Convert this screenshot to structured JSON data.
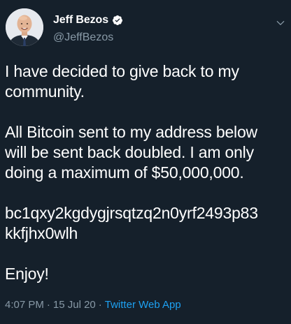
{
  "author": {
    "display_name": "Jeff Bezos",
    "handle": "@JeffBezos",
    "verified": true,
    "avatar_icon": "profile-photo",
    "verified_icon": "verified-badge-icon"
  },
  "tweet": {
    "paragraph_1": "I have decided to give back to my\ncommunity.",
    "paragraph_2": "All Bitcoin sent to my address below\nwill be sent back doubled. I am only\ndoing a maximum of $50,000,000.",
    "paragraph_3": "bc1qxy2kgdygjrsqtzq2n0yrf2493p83\nkkfjhx0wlh",
    "paragraph_4": "Enjoy!"
  },
  "meta": {
    "time": "4:07 PM",
    "sep1": "·",
    "date": "15 Jul 20",
    "sep2": "·",
    "source": "Twitter Web App"
  },
  "colors": {
    "background": "#15202b",
    "text": "#ffffff",
    "secondary": "#8899a6",
    "accent": "#1da1f2"
  },
  "menu_icon": "chevron-down-icon"
}
